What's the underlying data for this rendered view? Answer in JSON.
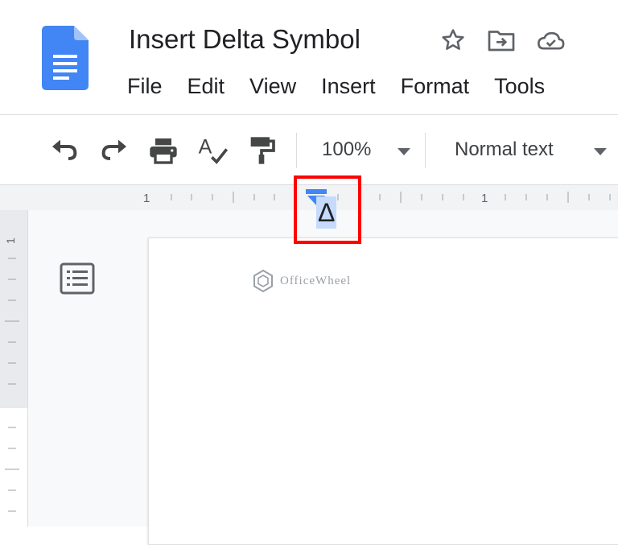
{
  "doc": {
    "title": "Insert Delta Symbol"
  },
  "title_icons": [
    "star-icon",
    "move-to-folder-icon",
    "cloud-saved-icon"
  ],
  "menu": [
    "File",
    "Edit",
    "View",
    "Insert",
    "Format",
    "Tools"
  ],
  "toolbar": {
    "icons": [
      "undo-icon",
      "redo-icon",
      "print-icon",
      "spellcheck-icon",
      "paint-format-icon"
    ],
    "zoom": "100%",
    "style": "Normal text"
  },
  "ruler": {
    "labels": [
      "1",
      "1"
    ]
  },
  "vertical_ruler": {
    "label": "1"
  },
  "document": {
    "content": "Δ"
  },
  "watermark": {
    "text": "OfficeWheel"
  },
  "colors": {
    "accent": "#4285f4",
    "highlight": "#c6dafc",
    "annotation": "#ff0000"
  }
}
